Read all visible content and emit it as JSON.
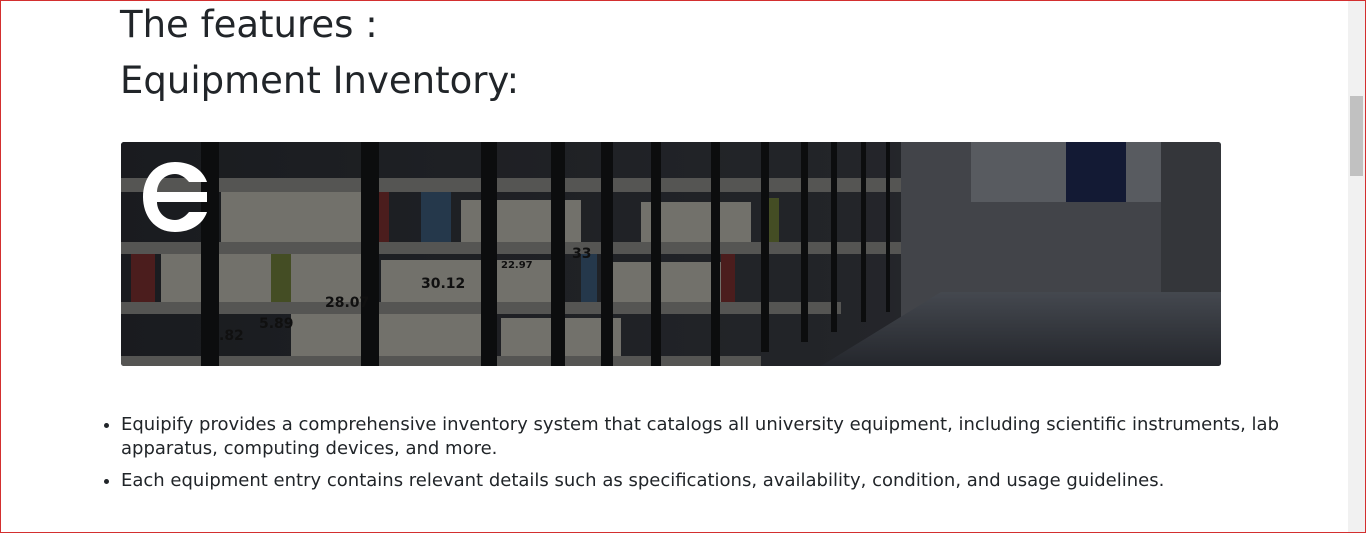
{
  "headings": {
    "features": "The features :",
    "inventory": "Equipment Inventory:"
  },
  "banner": {
    "image": "library-bookshelves-photo",
    "logo": "equipify-logo-icon",
    "shelf_labels": [
      "28.07",
      "30.12",
      "33",
      "5.89",
      ".82",
      "22.97"
    ]
  },
  "features": [
    "Equipify provides a comprehensive inventory system that catalogs all university equipment, including scientific instruments, lab apparatus, computing devices, and more.",
    "Each equipment entry contains relevant details such as specifications, availability, condition, and usage guidelines."
  ],
  "colors": {
    "text": "#212529",
    "frame": "#d32f2f",
    "banner_overlay": "#000000"
  }
}
